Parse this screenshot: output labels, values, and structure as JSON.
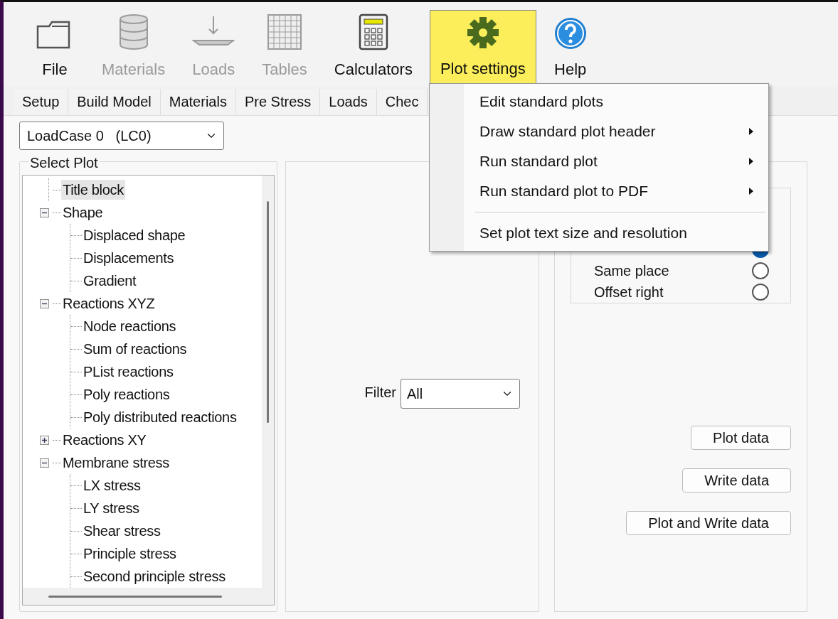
{
  "toolbar": [
    {
      "label": "File",
      "kind": "folder",
      "disabled": false,
      "open": false
    },
    {
      "label": "Materials",
      "kind": "database",
      "disabled": true,
      "open": false
    },
    {
      "label": "Loads",
      "kind": "load",
      "disabled": true,
      "open": false
    },
    {
      "label": "Tables",
      "kind": "table",
      "disabled": true,
      "open": false
    },
    {
      "label": "Calculators",
      "kind": "calculator",
      "disabled": false,
      "open": false
    },
    {
      "label": "Plot settings",
      "kind": "gear",
      "disabled": false,
      "open": true
    },
    {
      "label": "Help",
      "kind": "help",
      "disabled": false,
      "open": false
    }
  ],
  "menu": [
    {
      "label": "Edit standard plots",
      "submenu": false
    },
    {
      "label": "Draw standard plot header",
      "submenu": true
    },
    {
      "label": "Run standard plot",
      "submenu": true
    },
    {
      "label": "Run standard plot to PDF",
      "submenu": true
    },
    {
      "kind": "separator"
    },
    {
      "label": "Set plot text size and resolution",
      "submenu": false
    }
  ],
  "tabs": [
    {
      "label": "Setup",
      "selected": false
    },
    {
      "label": "Build Model",
      "selected": false
    },
    {
      "label": "Materials",
      "selected": false
    },
    {
      "label": "Pre Stress",
      "selected": false
    },
    {
      "label": "Loads",
      "selected": false
    },
    {
      "label": "Chec",
      "selected": false
    }
  ],
  "load_case": {
    "value": "LoadCase 0   (LC0)"
  },
  "select_plot": {
    "title": "Select Plot",
    "tree": [
      {
        "label": "Title block",
        "selected": true
      },
      {
        "label": "Shape",
        "selected": false,
        "expanded": true,
        "children": [
          {
            "label": "Displaced shape",
            "selected": false
          },
          {
            "label": "Displacements",
            "selected": false
          },
          {
            "label": "Gradient",
            "selected": false
          }
        ]
      },
      {
        "label": "Reactions XYZ",
        "selected": false,
        "expanded": true,
        "children": [
          {
            "label": "Node reactions",
            "selected": false
          },
          {
            "label": "Sum of reactions",
            "selected": false
          },
          {
            "label": "PList reactions",
            "selected": false
          },
          {
            "label": "Poly reactions",
            "selected": false
          },
          {
            "label": "Poly distributed reactions",
            "selected": false
          }
        ]
      },
      {
        "label": "Reactions XY",
        "selected": false,
        "expanded": false
      },
      {
        "label": "Membrane stress",
        "selected": false,
        "expanded": true,
        "children": [
          {
            "label": "LX stress",
            "selected": false
          },
          {
            "label": "LY stress",
            "selected": false
          },
          {
            "label": "Shear stress",
            "selected": false
          },
          {
            "label": "Principle stress",
            "selected": false
          },
          {
            "label": "Second principle stress",
            "selected": false
          }
        ]
      }
    ]
  },
  "filter": {
    "label": "Filter",
    "value": "All"
  },
  "position": [
    {
      "selected": true
    },
    {
      "label": "Same place",
      "selected": false
    },
    {
      "label": "Offset right",
      "selected": false
    }
  ],
  "buttons": [
    "Plot data",
    "Write data",
    "Plot and Write data"
  ]
}
